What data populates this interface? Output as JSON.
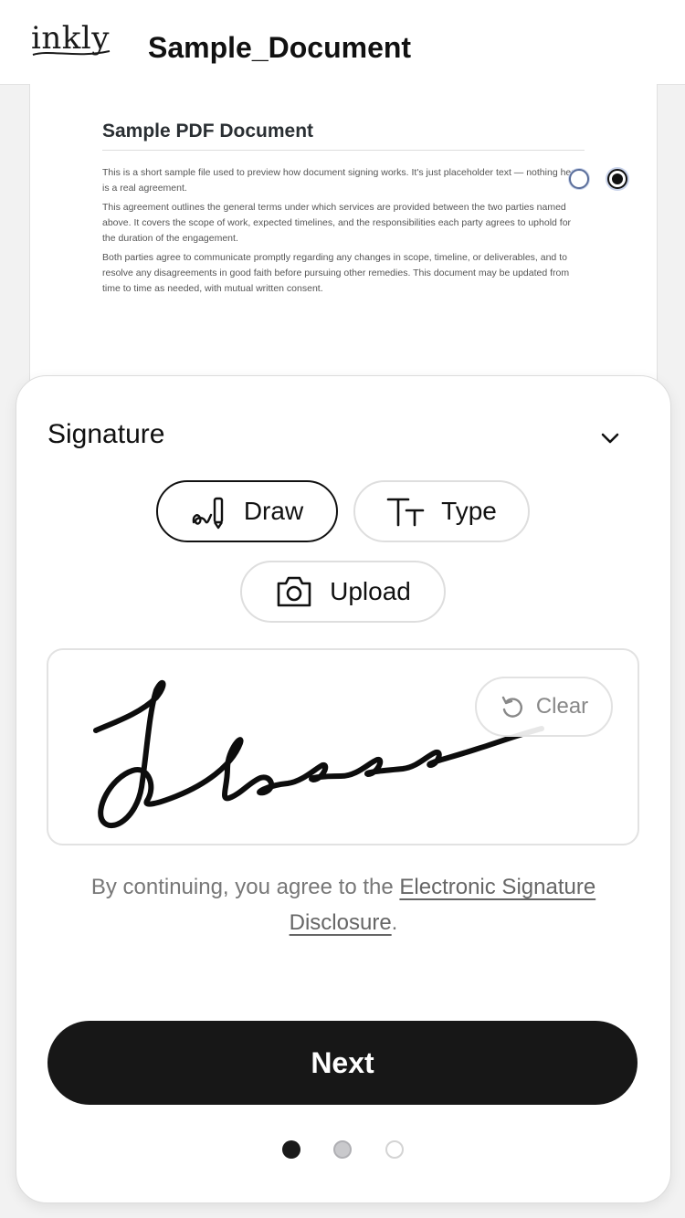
{
  "header": {
    "logo_text": "inkly",
    "document_title": "Sample_Document"
  },
  "document": {
    "heading": "Sample PDF Document",
    "paragraphs": [
      "This is a short sample file used to preview how document signing works. It's just placeholder text — nothing here is a real agreement.",
      "This agreement outlines the general terms under which services are provided between the two parties named above. It covers the scope of work, expected timelines, and the responsibilities each party agrees to uphold for the duration of the engagement.",
      "Both parties agree to communicate promptly regarding any changes in scope, timeline, or deliverables, and to resolve any disagreements in good faith before pursuing other remedies. This document may be updated from time to time as needed, with mutual written consent."
    ]
  },
  "signature_panel": {
    "title": "Signature",
    "modes": {
      "draw": "Draw",
      "type": "Type",
      "upload": "Upload"
    },
    "active_mode": "Draw",
    "clear_label": "Clear",
    "consent_prefix": "By continuing, you agree to the ",
    "consent_link": "Electronic Signature Disclosure",
    "consent_suffix": ".",
    "next_label": "Next",
    "steps": {
      "current": 1,
      "total": 3
    }
  },
  "icons": {
    "collapse": "chevron-down-icon",
    "draw": "pen-signature-icon",
    "type": "text-size-icon",
    "upload": "camera-icon",
    "clear": "undo-icon"
  },
  "colors": {
    "primary": "#171717",
    "background": "#f2f2f2",
    "muted_text": "#777777"
  }
}
